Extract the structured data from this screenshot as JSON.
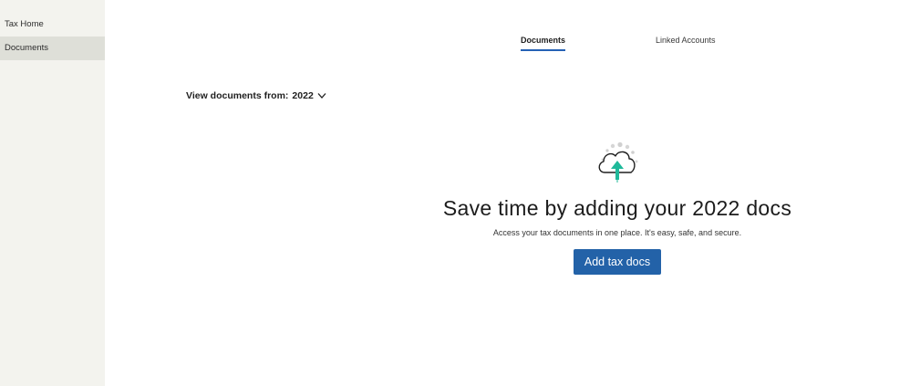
{
  "sidebar": {
    "items": [
      {
        "label": "Tax Home",
        "active": false
      },
      {
        "label": "Documents",
        "active": true
      }
    ]
  },
  "tabs": [
    {
      "label": "Documents",
      "active": true
    },
    {
      "label": "Linked Accounts",
      "active": false
    }
  ],
  "filter": {
    "label": "View documents from:",
    "selected_year": "2022",
    "icon": "chevron-down-icon"
  },
  "empty_state": {
    "icon": "cloud-upload-icon",
    "headline": "Save time by adding your 2022 docs",
    "subtext": "Access your tax documents in one place. It's easy, safe, and secure.",
    "button_label": "Add tax docs"
  },
  "colors": {
    "accent": "#2362a8",
    "upload_arrow": "#1fb99a",
    "sidebar_bg": "#f3f3ee",
    "sidebar_active_bg": "#dedfd8"
  }
}
